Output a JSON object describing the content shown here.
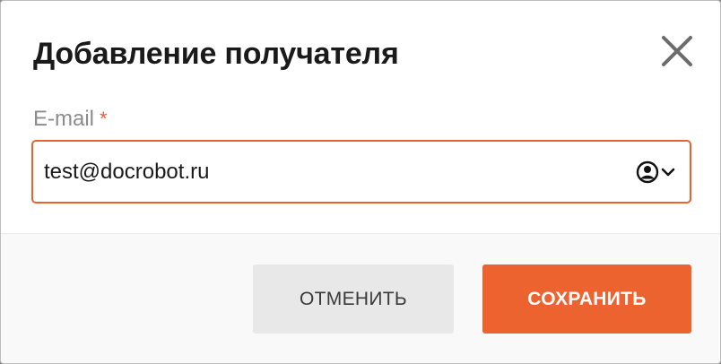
{
  "dialog": {
    "title": "Добавление получателя"
  },
  "email_field": {
    "label": "E-mail",
    "required_mark": "*",
    "value": "test@docrobot.ru"
  },
  "actions": {
    "cancel_label": "ОТМЕНИТЬ",
    "save_label": "СОХРАНИТЬ"
  },
  "icons": {
    "close": "close-icon",
    "contact_picker": "user-circle-icon",
    "dropdown": "chevron-down-icon"
  },
  "colors": {
    "accent": "#ec6330",
    "input_border": "#e8642f",
    "required": "#e1613a",
    "cancel_bg": "#e8e8e8"
  }
}
